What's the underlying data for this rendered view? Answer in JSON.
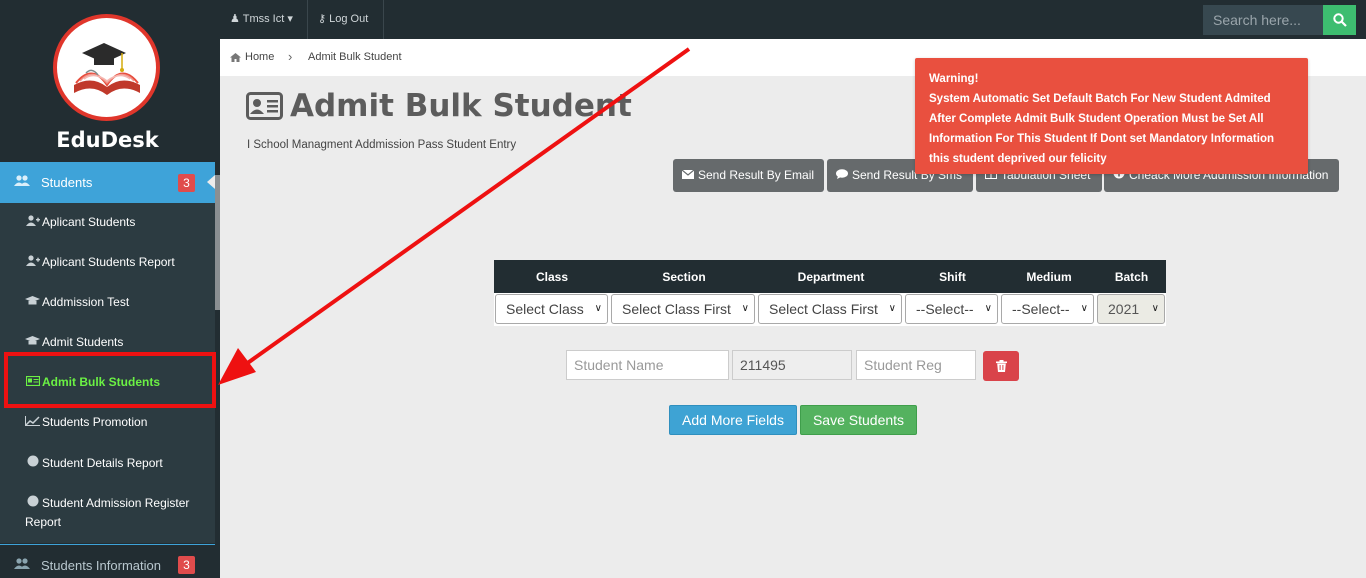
{
  "brand": {
    "name": "EduDesk"
  },
  "topbar": {
    "user_label": "Tmss Ict",
    "logout_label": "Log Out",
    "search_placeholder": "Search here..."
  },
  "breadcrumb": {
    "home": "Home",
    "current": "Admit Bulk Student"
  },
  "sidebar": {
    "active_menu": {
      "label": "Students",
      "badge": "3"
    },
    "items": [
      {
        "label": "Aplicant Students",
        "icon": "user-add-icon"
      },
      {
        "label": "Aplicant Students Report",
        "icon": "user-add-icon"
      },
      {
        "label": "Addmission Test",
        "icon": "graduation-cap-icon"
      },
      {
        "label": "Admit Students",
        "icon": "graduation-cap-icon"
      },
      {
        "label": "Admit Bulk Students",
        "icon": "id-card-icon"
      },
      {
        "label": "Students Promotion",
        "icon": "line-chart-icon"
      },
      {
        "label": "Student Details Report",
        "icon": "circle-icon"
      },
      {
        "label": "Student Admission Register",
        "icon": "circle-icon"
      },
      {
        "label": "Report",
        "icon": ""
      }
    ],
    "bottom_menu": {
      "label": "Students Information",
      "badge": "3"
    }
  },
  "page": {
    "title": "Admit Bulk Student",
    "subtitle": "I School Managment Addmission Pass Student Entry"
  },
  "actions": {
    "email": "Send Result By Email",
    "sms": "Send Result By Sms",
    "tabulation": "Tabulation Sheet",
    "more": "Cheack More Addmission Information"
  },
  "warning": {
    "title": "Warning!",
    "line1": "System Automatic Set Default Batch For New Student Admited",
    "line2": "After Complete Admit Bulk Student Operation Must be Set All",
    "line3": "Information For This Student If Dont set Mandatory Information",
    "line4": "this student deprived our felicity"
  },
  "table": {
    "headers": [
      "Class",
      "Section",
      "Department",
      "Shift",
      "Medium",
      "Batch"
    ],
    "selects": [
      "Select Class",
      "Select Class First",
      "Select Class First",
      "--Select--",
      "--Select--",
      "2021"
    ]
  },
  "form": {
    "name_placeholder": "Student Name",
    "id_value": "211495",
    "reg_placeholder": "Student Reg",
    "add_more": "Add More Fields",
    "save": "Save Students"
  },
  "colors": {
    "accent": "#3ea3d9",
    "danger": "#e9503f",
    "success": "#54b25f",
    "sidebar": "#222d32",
    "active_item": "#6bf144"
  }
}
